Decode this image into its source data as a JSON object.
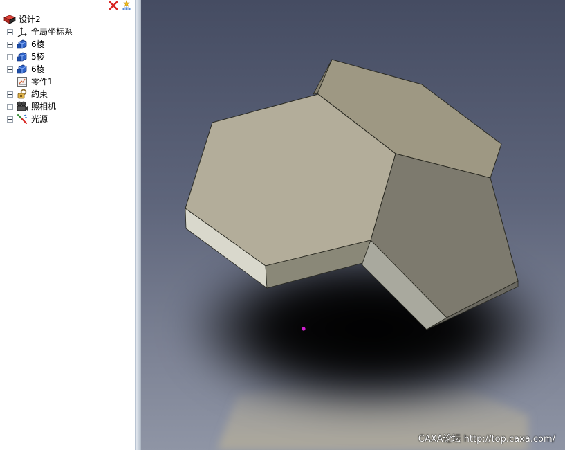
{
  "tree": {
    "root_label": "设计2",
    "items": [
      {
        "label": "全局坐标系",
        "icon": "axes-icon",
        "expandable": true
      },
      {
        "label": "6棱",
        "icon": "solid-part-icon",
        "expandable": true
      },
      {
        "label": "5棱",
        "icon": "solid-part-icon",
        "expandable": true
      },
      {
        "label": "6棱",
        "icon": "solid-part-icon",
        "expandable": true
      },
      {
        "label": "零件1",
        "icon": "part-sketch-icon",
        "expandable": false
      },
      {
        "label": "约束",
        "icon": "constraint-icon",
        "expandable": true
      },
      {
        "label": "照相机",
        "icon": "camera-icon",
        "expandable": true
      },
      {
        "label": "光源",
        "icon": "light-icon",
        "expandable": true
      }
    ]
  },
  "panel_tools": {
    "close_icon": "close-icon",
    "filter_icon": "filter-icon"
  },
  "viewport": {
    "watermark": "CAXA论坛 http://top.caxa.com/",
    "colors": {
      "bg_top": "#454c62",
      "bg_bottom": "#8f95a5",
      "face_hex_front": "#b3ad9a",
      "face_hex_back": "#9e9883",
      "face_pent": "#7d7a6e",
      "side_light": "#d9d8cc",
      "side_mid": "#8a8878",
      "point": "#d020d0"
    }
  }
}
